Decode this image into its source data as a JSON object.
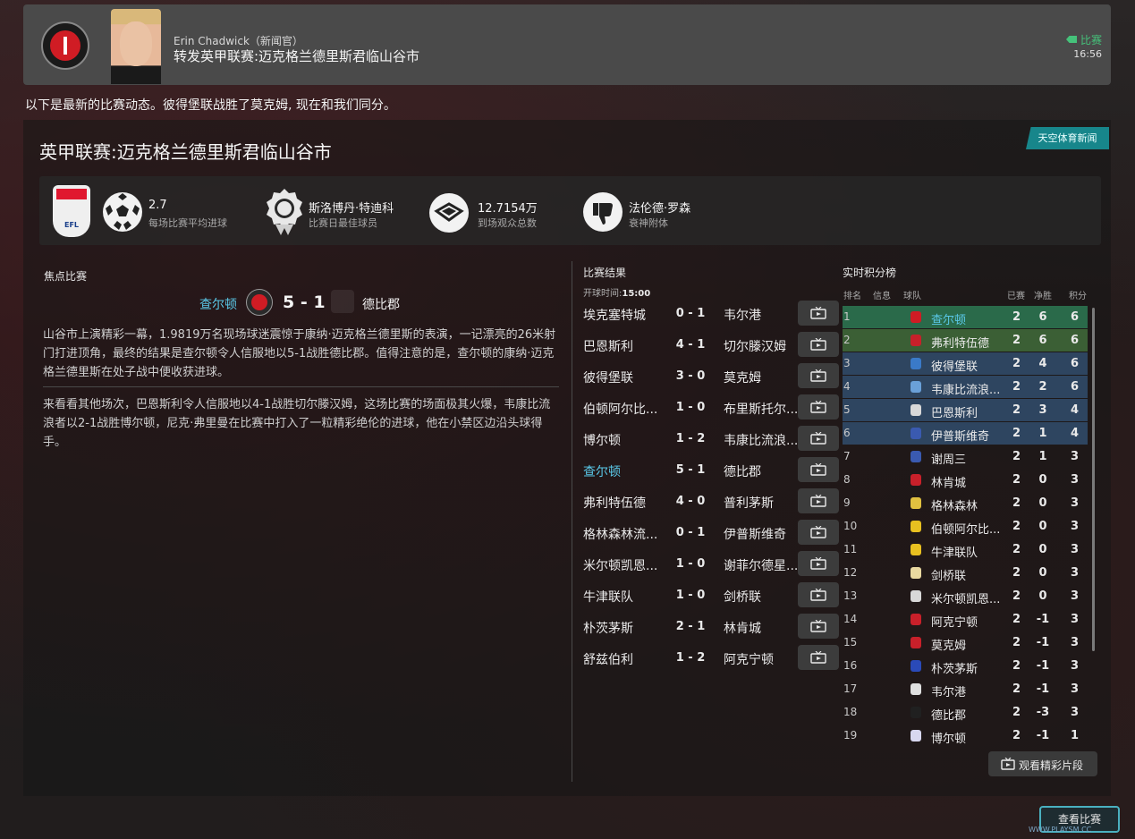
{
  "header": {
    "author": "Erin Chadwick（新闻官）",
    "headline": "转发英甲联赛:迈克格兰德里斯君临山谷市",
    "tag": "比赛",
    "time": "16:56"
  },
  "intro": "以下是最新的比赛动态。彼得堡联战胜了莫克姆, 现在和我们同分。",
  "panel": {
    "title": "英甲联赛:迈克格兰德里斯君临山谷市",
    "source": "天空体育新闻"
  },
  "stats": [
    {
      "value": "2.7",
      "label": "每场比赛平均进球",
      "icon": "football-icon"
    },
    {
      "value": "斯洛博丹·特迪科",
      "label": "比赛日最佳球员",
      "icon": "medal-icon"
    },
    {
      "value": "12.7154万",
      "label": "到场观众总数",
      "icon": "stadium-icon"
    },
    {
      "value": "法伦德·罗森",
      "label": "衰神附体",
      "icon": "thumbs-down-icon"
    }
  ],
  "focus": {
    "label": "焦点比赛",
    "home": "查尔顿",
    "score": "5 - 1",
    "away": "德比郡",
    "para1": "山谷市上演精彩一幕，1.9819万名现场球迷震惊于康纳·迈克格兰德里斯的表演，一记漂亮的26米射门打进顶角，最终的结果是查尔顿令人信服地以5-1战胜德比郡。值得注意的是，查尔顿的康纳·迈克格兰德里斯在处子战中便收获进球。",
    "para2": "来看看其他场次，巴恩斯利令人信服地以4-1战胜切尔滕汉姆，这场比赛的场面极其火爆，韦康比流浪者以2-1战胜博尔顿，尼克·弗里曼在比赛中打入了一粒精彩绝伦的进球，他在小禁区边沿头球得手。"
  },
  "results": {
    "label": "比赛结果",
    "ko_label": "开球时间:",
    "ko_time": "15:00",
    "rows": [
      {
        "home": "埃克塞特城",
        "score": "0 - 1",
        "away": "韦尔港"
      },
      {
        "home": "巴恩斯利",
        "score": "4 - 1",
        "away": "切尔滕汉姆"
      },
      {
        "home": "彼得堡联",
        "score": "3 - 0",
        "away": "莫克姆"
      },
      {
        "home": "伯顿阿尔比...",
        "score": "1 - 0",
        "away": "布里斯托尔..."
      },
      {
        "home": "博尔顿",
        "score": "1 - 2",
        "away": "韦康比流浪..."
      },
      {
        "home": "查尔顿",
        "score": "5 - 1",
        "away": "德比郡",
        "highlight": true
      },
      {
        "home": "弗利特伍德",
        "score": "4 - 0",
        "away": "普利茅斯"
      },
      {
        "home": "格林森林流...",
        "score": "0 - 1",
        "away": "伊普斯维奇"
      },
      {
        "home": "米尔顿凯恩...",
        "score": "1 - 0",
        "away": "谢菲尔德星..."
      },
      {
        "home": "牛津联队",
        "score": "1 - 0",
        "away": "剑桥联"
      },
      {
        "home": "朴茨茅斯",
        "score": "2 - 1",
        "away": "林肯城"
      },
      {
        "home": "舒兹伯利",
        "score": "1 - 2",
        "away": "阿克宁顿"
      }
    ]
  },
  "table": {
    "label": "实时积分榜",
    "headers": {
      "pos": "排名",
      "info": "信息",
      "team": "球队",
      "pld": "已赛",
      "gd": "净胜",
      "pts": "积分"
    },
    "rows": [
      {
        "pos": "1",
        "team": "查尔顿",
        "pld": "2",
        "gd": "6",
        "pts": "6",
        "bg": "#2a6a4a",
        "badge": "#d01c24",
        "hl": true
      },
      {
        "pos": "2",
        "team": "弗利特伍德",
        "pld": "2",
        "gd": "6",
        "pts": "6",
        "bg": "#3b5f35",
        "badge": "#c8202a"
      },
      {
        "pos": "3",
        "team": "彼得堡联",
        "pld": "2",
        "gd": "4",
        "pts": "6",
        "bg": "#2e4560",
        "badge": "#3a7ac8"
      },
      {
        "pos": "4",
        "team": "韦康比流浪...",
        "pld": "2",
        "gd": "2",
        "pts": "6",
        "bg": "#2e4560",
        "badge": "#6aa0d8"
      },
      {
        "pos": "5",
        "team": "巴恩斯利",
        "pld": "2",
        "gd": "3",
        "pts": "4",
        "bg": "#2e4560",
        "badge": "#d8d8d8"
      },
      {
        "pos": "6",
        "team": "伊普斯维奇",
        "pld": "2",
        "gd": "1",
        "pts": "4",
        "bg": "#2e4560",
        "badge": "#3a5ab0"
      },
      {
        "pos": "7",
        "team": "谢周三",
        "pld": "2",
        "gd": "1",
        "pts": "3",
        "bg": "",
        "badge": "#3a5ab0"
      },
      {
        "pos": "8",
        "team": "林肯城",
        "pld": "2",
        "gd": "0",
        "pts": "3",
        "bg": "",
        "badge": "#c8202a"
      },
      {
        "pos": "9",
        "team": "格林森林",
        "pld": "2",
        "gd": "0",
        "pts": "3",
        "bg": "",
        "badge": "#e0c040"
      },
      {
        "pos": "10",
        "team": "伯顿阿尔比...",
        "pld": "2",
        "gd": "0",
        "pts": "3",
        "bg": "",
        "badge": "#e8c020"
      },
      {
        "pos": "11",
        "team": "牛津联队",
        "pld": "2",
        "gd": "0",
        "pts": "3",
        "bg": "",
        "badge": "#e8c020"
      },
      {
        "pos": "12",
        "team": "剑桥联",
        "pld": "2",
        "gd": "0",
        "pts": "3",
        "bg": "",
        "badge": "#e8d8a0"
      },
      {
        "pos": "13",
        "team": "米尔顿凯恩...",
        "pld": "2",
        "gd": "0",
        "pts": "3",
        "bg": "",
        "badge": "#d8d8d8"
      },
      {
        "pos": "14",
        "team": "阿克宁顿",
        "pld": "2",
        "gd": "-1",
        "pts": "3",
        "bg": "",
        "badge": "#c8202a"
      },
      {
        "pos": "15",
        "team": "莫克姆",
        "pld": "2",
        "gd": "-1",
        "pts": "3",
        "bg": "",
        "badge": "#c8202a"
      },
      {
        "pos": "16",
        "team": "朴茨茅斯",
        "pld": "2",
        "gd": "-1",
        "pts": "3",
        "bg": "",
        "badge": "#2a4ab8"
      },
      {
        "pos": "17",
        "team": "韦尔港",
        "pld": "2",
        "gd": "-1",
        "pts": "3",
        "bg": "",
        "badge": "#e0e0e0"
      },
      {
        "pos": "18",
        "team": "德比郡",
        "pld": "2",
        "gd": "-3",
        "pts": "3",
        "bg": "",
        "badge": "#202020"
      },
      {
        "pos": "19",
        "team": "博尔顿",
        "pld": "2",
        "gd": "-1",
        "pts": "1",
        "bg": "",
        "badge": "#d8d8f0"
      }
    ]
  },
  "buttons": {
    "highlights": "观看精彩片段",
    "continue": "查看比赛"
  },
  "watermark": "WWW.PLAYSM.CC",
  "colors": {
    "accent": "#5ac8e8",
    "tag_green": "#45c27a",
    "source_teal": "#17868b"
  }
}
